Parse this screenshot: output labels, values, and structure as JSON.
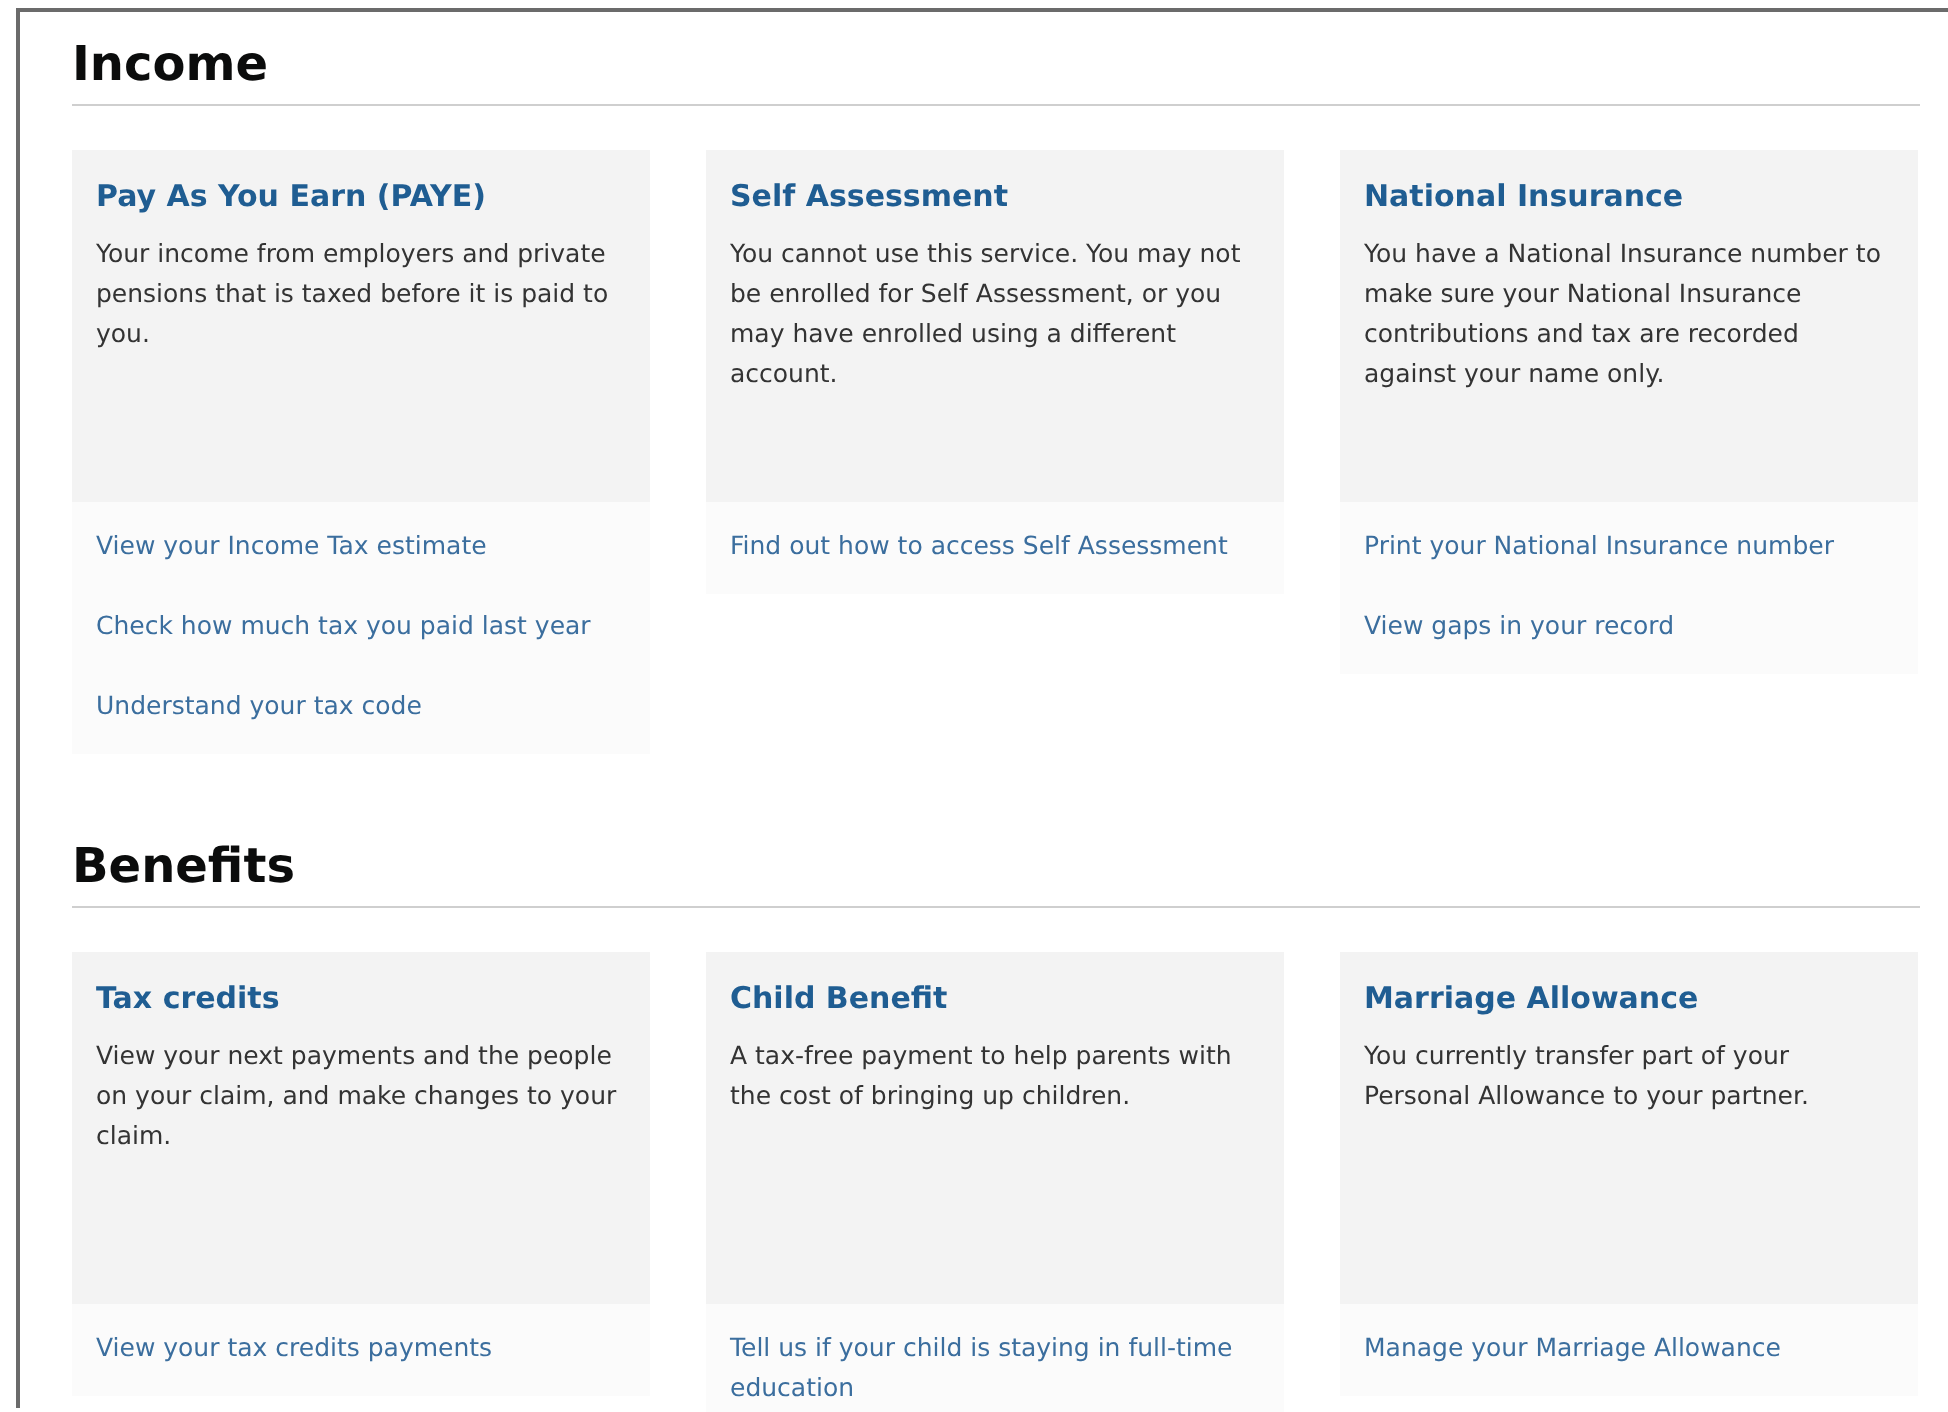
{
  "sections": [
    {
      "heading": "Income",
      "cards": [
        {
          "title": "Pay As You Earn (PAYE)",
          "description": "Your income from employers and private pensions that is taxed before it is paid to you.",
          "links": [
            "View your Income Tax estimate",
            "Check how much tax you paid last year",
            "Understand your tax code"
          ]
        },
        {
          "title": "Self Assessment",
          "description": "You cannot use this service. You may not be enrolled for Self Assessment, or you may have enrolled using a different account.",
          "links": [
            "Find out how to access Self Assessment"
          ]
        },
        {
          "title": "National Insurance",
          "description": "You have a National Insurance number to make sure your National Insurance contributions and tax are recorded against your name only.",
          "links": [
            "Print your National Insurance number",
            "View gaps in your record"
          ]
        }
      ]
    },
    {
      "heading": "Benefits",
      "cards": [
        {
          "title": "Tax credits",
          "description": "View your next payments and the people on your claim, and make changes to your claim.",
          "links": [
            "View your tax credits payments"
          ]
        },
        {
          "title": "Child Benefit",
          "description": "A tax-free payment to help parents with the cost of bringing up children.",
          "links": [
            "Tell us if your child is staying in full-time education"
          ]
        },
        {
          "title": "Marriage Allowance",
          "description": "You currently transfer part of your Personal Allowance to your partner.",
          "links": [
            "Manage your Marriage Allowance"
          ]
        }
      ]
    }
  ]
}
